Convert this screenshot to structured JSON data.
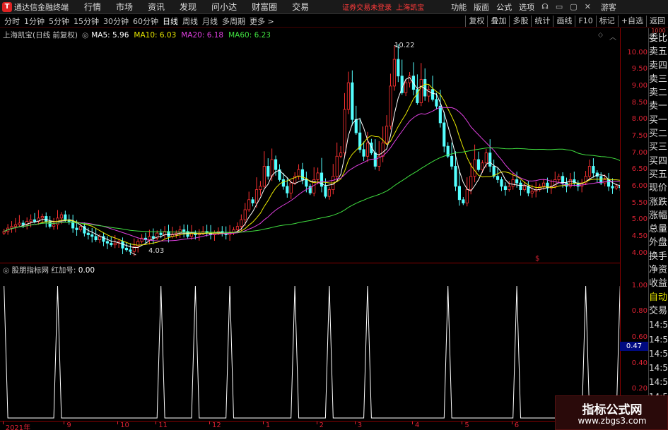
{
  "menubar": {
    "app_title": "通达信金融终端",
    "items": [
      "行情",
      "市场",
      "资讯",
      "发现",
      "问小达",
      "财富圈",
      "交易"
    ],
    "login_tip": "证券交易未登录",
    "login_stock": "上海凯宝",
    "right_items": [
      "功能",
      "版面",
      "公式",
      "选项"
    ],
    "guest": "游客"
  },
  "periodbar": {
    "periods": [
      "分时",
      "1分钟",
      "5分钟",
      "15分钟",
      "30分钟",
      "60分钟",
      "日线",
      "周线",
      "月线",
      "多周期",
      "更多 >"
    ],
    "active_period": "日线",
    "tools": [
      "复权",
      "叠加",
      "多股",
      "统计",
      "画线",
      "F10",
      "标记",
      "+自选",
      "返回"
    ]
  },
  "main_chart": {
    "stock_label": "上海凯宝(日线 前复权)",
    "ma": [
      {
        "label": "MA5: 5.96",
        "color": "#ffffff"
      },
      {
        "label": "MA10: 6.03",
        "color": "#e8e800"
      },
      {
        "label": "MA20: 6.18",
        "color": "#e040e0"
      },
      {
        "label": "MA60: 6.23",
        "color": "#40e040"
      }
    ],
    "max_label": "10.22",
    "min_label": "4.03",
    "marker": "$"
  },
  "sub_chart": {
    "title": "股朋指标网 红加号:",
    "value": "0.00",
    "cursor_value": "0.47"
  },
  "right_panel": {
    "top_label": "1000",
    "items": [
      "委比",
      "卖五",
      "卖四",
      "卖三",
      "卖二",
      "卖一",
      "买一",
      "买二",
      "买三",
      "买四",
      "买五",
      "现价",
      "涨跌",
      "涨幅",
      "总量",
      "外盘",
      "换手",
      "净资",
      "收益",
      "自动",
      "交易"
    ],
    "times": [
      "14:56",
      "14:56",
      "14:56",
      "14:56",
      "14:56",
      "14:56"
    ]
  },
  "watermark": {
    "title": "指标公式网",
    "url": "www.zbgs3.com"
  },
  "chart_data": [
    {
      "type": "candlestick",
      "y_ticks": [
        "10.00",
        "9.50",
        "9.00",
        "8.50",
        "8.00",
        "7.50",
        "7.00",
        "6.50",
        "6.00",
        "5.50",
        "5.00",
        "4.50",
        "4.00"
      ],
      "ylim": [
        3.8,
        10.35
      ],
      "x_labels": [
        "2021年",
        "9",
        "10",
        "11",
        "12",
        "1",
        "2",
        "3",
        "4",
        "5",
        "6",
        "8"
      ],
      "x_index": [
        0,
        16,
        30,
        40,
        54,
        68,
        82,
        92,
        107,
        120,
        133,
        160
      ],
      "close": [
        4.65,
        4.75,
        4.8,
        4.85,
        4.9,
        4.85,
        4.95,
        5.0,
        4.95,
        5.05,
        5.1,
        4.95,
        4.8,
        4.85,
        5.05,
        5.15,
        5.0,
        4.95,
        4.75,
        4.7,
        4.8,
        4.6,
        4.55,
        4.5,
        4.4,
        4.5,
        4.35,
        4.3,
        4.25,
        4.3,
        4.35,
        4.15,
        4.1,
        4.05,
        4.2,
        4.35,
        4.45,
        4.4,
        4.5,
        4.45,
        4.6,
        4.55,
        4.65,
        4.5,
        4.55,
        4.6,
        4.7,
        4.65,
        4.5,
        4.6,
        4.55,
        4.6,
        4.65,
        4.6,
        4.55,
        4.6,
        4.65,
        4.6,
        4.55,
        4.6,
        4.7,
        4.8,
        5.0,
        5.3,
        5.6,
        5.5,
        5.9,
        6.0,
        6.6,
        6.3,
        6.8,
        6.5,
        6.2,
        6.0,
        5.8,
        6.1,
        6.3,
        6.5,
        6.2,
        6.0,
        5.8,
        6.2,
        6.4,
        6.0,
        5.7,
        5.9,
        6.3,
        6.9,
        7.0,
        8.3,
        9.1,
        8.0,
        7.6,
        7.1,
        6.9,
        7.3,
        7.0,
        6.6,
        6.9,
        7.3,
        7.8,
        9.0,
        9.8,
        9.3,
        8.8,
        9.1,
        9.3,
        8.9,
        8.5,
        9.2,
        8.7,
        8.9,
        8.6,
        8.4,
        7.9,
        7.2,
        6.9,
        6.6,
        6.0,
        5.6,
        5.5,
        5.9,
        6.3,
        6.8,
        6.5,
        6.7,
        7.0,
        6.6,
        6.3,
        6.2,
        6.0,
        5.9,
        6.0,
        6.2,
        6.1,
        5.9,
        6.0,
        5.8,
        5.85,
        5.9,
        6.0,
        6.1,
        5.95,
        6.0,
        6.2,
        6.3,
        6.1,
        6.0,
        6.2,
        6.1,
        6.0,
        6.1,
        6.3,
        6.6,
        6.4,
        6.3,
        6.1,
        6.2,
        6.0,
        5.95,
        6.0,
        5.96
      ]
    },
    {
      "type": "line",
      "name": "红加号",
      "ylim": [
        0,
        1.08
      ],
      "y_ticks": [
        "1.00",
        "0.80",
        "0.60",
        "0.40",
        "0.20"
      ],
      "spikes_at": [
        0,
        14,
        41,
        50,
        59,
        76,
        85,
        95,
        116,
        134,
        152,
        161
      ]
    }
  ]
}
